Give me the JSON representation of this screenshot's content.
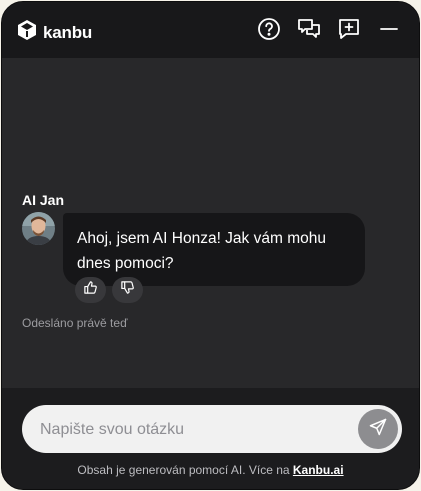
{
  "header": {
    "brand_name": "kanbu",
    "icons": [
      "help-icon",
      "conversations-icon",
      "new-chat-icon",
      "minimize-icon"
    ]
  },
  "message": {
    "sender": "AI Jan",
    "text": "Ahoj, jsem AI Honza! Jak vám mohu dnes pomoci?",
    "status": "Odesláno právě teď",
    "reactions": [
      "thumbs-up-icon",
      "thumbs-down-icon"
    ]
  },
  "composer": {
    "placeholder": "Napište svou otázku",
    "value": ""
  },
  "disclaimer": {
    "text": "Obsah je generován pomocí AI. Více na ",
    "link_label": "Kanbu.ai"
  },
  "colors": {
    "panel": "#28282a",
    "header": "#18181a",
    "bubble": "#161618",
    "send_button": "#8d8d90"
  }
}
